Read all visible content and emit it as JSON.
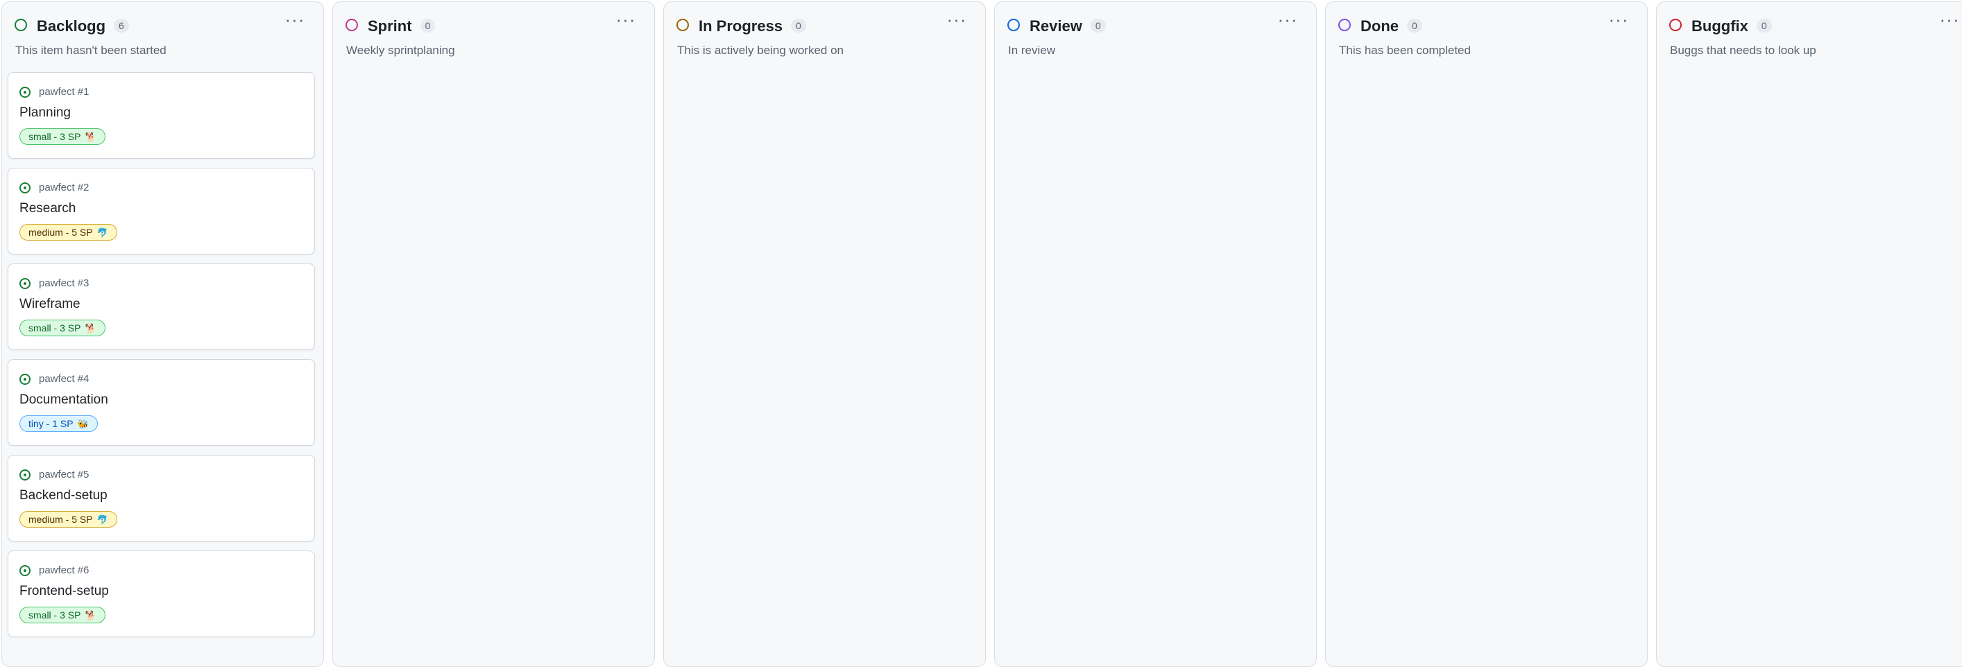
{
  "columns": [
    {
      "title": "Backlogg",
      "count": "6",
      "description": "This item hasn't been started",
      "dot_color": "#1a7f37"
    },
    {
      "title": "Sprint",
      "count": "0",
      "description": "Weekly sprintplaning",
      "dot_color": "#bf3989"
    },
    {
      "title": "In Progress",
      "count": "0",
      "description": "This is actively being worked on",
      "dot_color": "#9a6700"
    },
    {
      "title": "Review",
      "count": "0",
      "description": "In review",
      "dot_color": "#0969da"
    },
    {
      "title": "Done",
      "count": "0",
      "description": "This has been completed",
      "dot_color": "#8250df"
    },
    {
      "title": "Buggfix",
      "count": "0",
      "description": "Buggs that needs to look up",
      "dot_color": "#cf222e"
    }
  ],
  "column_menu_label": "···",
  "cards": [
    {
      "repo": "pawfect",
      "number": "#1",
      "title": "Planning",
      "label": "small - 3 SP",
      "label_emoji": "🐕",
      "label_colors": {
        "bg": "#dafbe1",
        "border": "#4ac26b",
        "text": "#116329"
      }
    },
    {
      "repo": "pawfect",
      "number": "#2",
      "title": "Research",
      "label": "medium - 5 SP",
      "label_emoji": "🐬",
      "label_colors": {
        "bg": "#fff8c5",
        "border": "#d4a72c",
        "text": "#4d2d00"
      }
    },
    {
      "repo": "pawfect",
      "number": "#3",
      "title": "Wireframe",
      "label": "small - 3 SP",
      "label_emoji": "🐕",
      "label_colors": {
        "bg": "#dafbe1",
        "border": "#4ac26b",
        "text": "#116329"
      }
    },
    {
      "repo": "pawfect",
      "number": "#4",
      "title": "Documentation",
      "label": "tiny - 1 SP",
      "label_emoji": "🐝",
      "label_colors": {
        "bg": "#ddf4ff",
        "border": "#54aeff",
        "text": "#0550ae"
      }
    },
    {
      "repo": "pawfect",
      "number": "#5",
      "title": "Backend-setup",
      "label": "medium - 5 SP",
      "label_emoji": "🐬",
      "label_colors": {
        "bg": "#fff8c5",
        "border": "#d4a72c",
        "text": "#4d2d00"
      }
    },
    {
      "repo": "pawfect",
      "number": "#6",
      "title": "Frontend-setup",
      "label": "small - 3 SP",
      "label_emoji": "🐕",
      "label_colors": {
        "bg": "#dafbe1",
        "border": "#4ac26b",
        "text": "#116329"
      }
    }
  ]
}
